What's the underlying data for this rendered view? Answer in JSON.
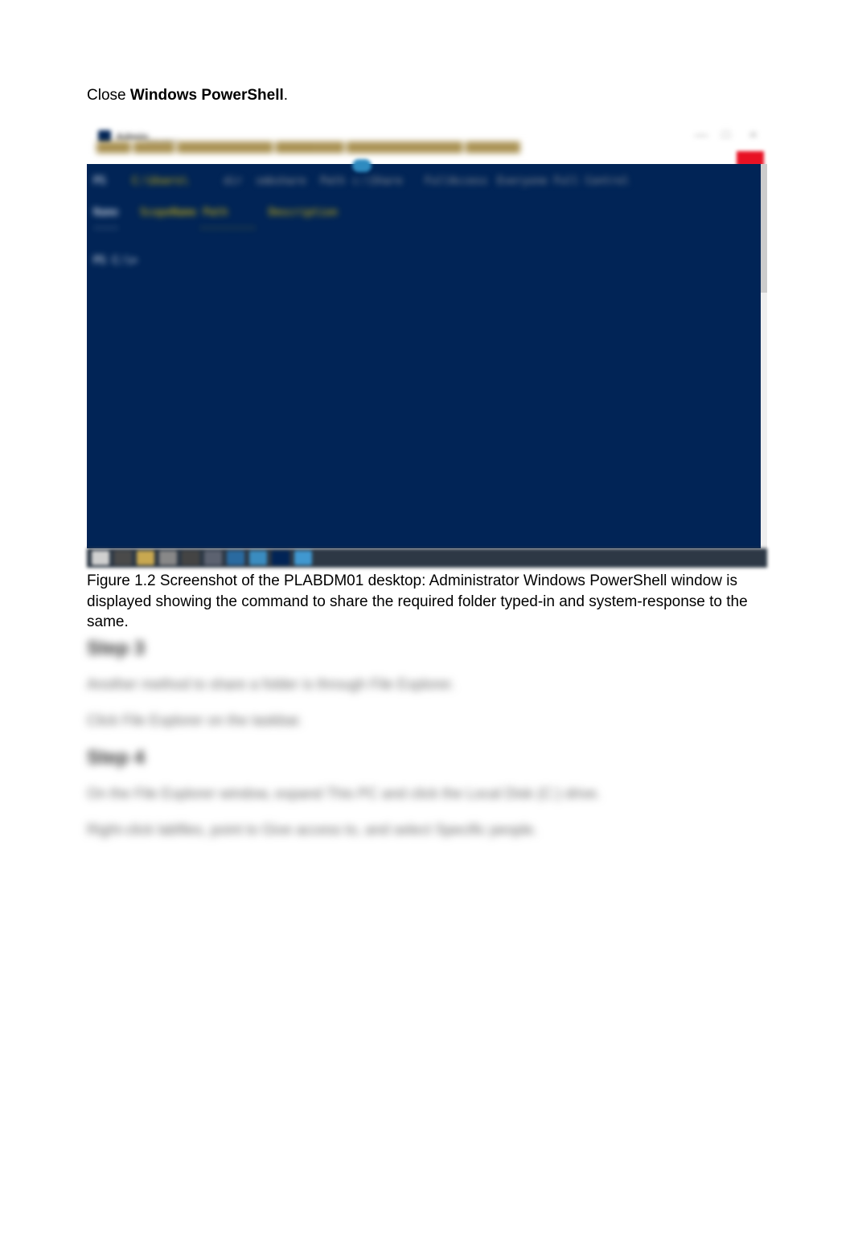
{
  "instruction": {
    "prefix": "Close ",
    "bold": "Windows PowerShell",
    "suffix": "."
  },
  "window": {
    "title": "Admin",
    "subtitle": "istrator"
  },
  "terminal": {
    "line1a": "PS",
    "line1b": "C:\\Users\\",
    "line1c": "dir",
    "line1d": "smbshare",
    "line1e": "Path",
    "line1f": "c:\\Share",
    "line1g": "FullAccess",
    "line1h": "Everyone Full Control",
    "line2a": "Name",
    "line2b": "ScopeName Path",
    "line2c": "Description",
    "line3a": "----",
    "line3b": "---------",
    "line4": "PS C:\\>"
  },
  "caption": "Figure 1.2 Screenshot of the PLABDM01 desktop: Administrator Windows PowerShell window is displayed showing the command to share the required folder typed-in and system-response to the same.",
  "steps": {
    "step3_heading": "Step 3",
    "step3_para1": "Another method to share a folder is through File Explorer.",
    "step3_para2": "Click File Explorer on the taskbar.",
    "step4_heading": "Step 4",
    "step4_para1": "On the File Explorer window, expand This PC and click the Local Disk (C:) drive.",
    "step4_para2": "Right-click labfiles, point to Give access to, and select Specific people."
  }
}
